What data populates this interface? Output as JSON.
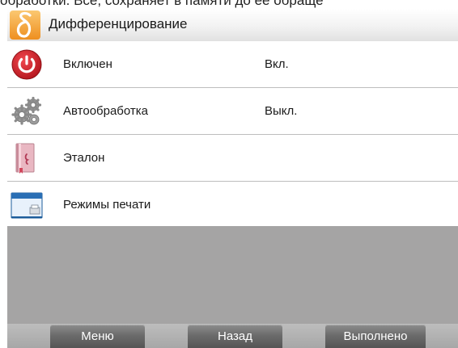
{
  "header_text": "обработки. Всё, сохраняет в памяти до её обраще",
  "title": {
    "text": "Дифференцирование",
    "icon": "delta-icon"
  },
  "menu": {
    "items": [
      {
        "label": "Включен",
        "value": "Вкл.",
        "icon": "power-icon"
      },
      {
        "label": "Автообработка",
        "value": "Выкл.",
        "icon": "gears-icon"
      },
      {
        "label": "Эталон",
        "value": "",
        "icon": "book-icon"
      },
      {
        "label": "Режимы печати",
        "value": "",
        "icon": "print-window-icon"
      }
    ]
  },
  "softkeys": {
    "menu": "Меню",
    "back": "Назад",
    "done": "Выполнено"
  },
  "colors": {
    "accent": "#f7a83b",
    "power": "#d2202a",
    "empty_area": "#a5a4a4",
    "softkey": "#6c6c6c"
  }
}
